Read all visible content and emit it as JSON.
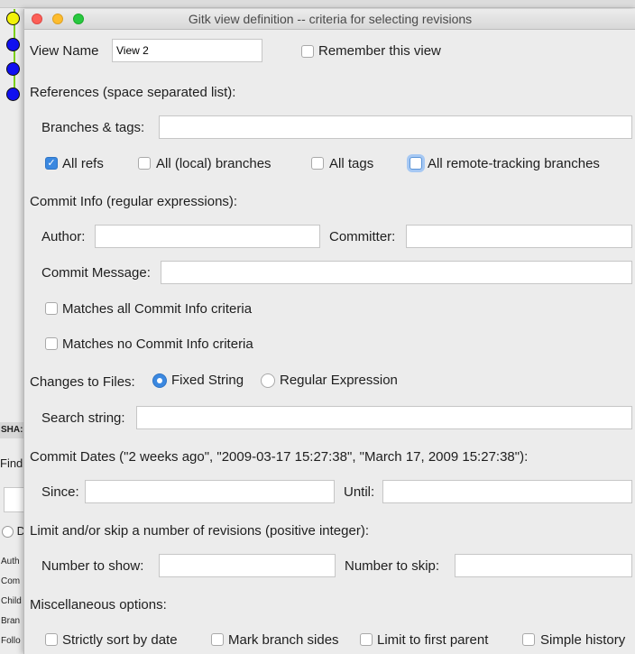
{
  "window": {
    "title": "Gitk view definition -- criteria for selecting revisions"
  },
  "background": {
    "sha_label": "SHA:",
    "find_label": "Find",
    "radio_label": "D",
    "list": [
      "Auth",
      "Com",
      "Child",
      "Bran",
      "Follo"
    ]
  },
  "view_name": {
    "label": "View Name",
    "value": "View 2"
  },
  "remember": {
    "label": "Remember this view",
    "checked": false
  },
  "references": {
    "heading": "References (space separated list):",
    "branches_label": "Branches & tags:",
    "branches_value": "",
    "all_refs": {
      "label": "All refs",
      "checked": true
    },
    "all_local": {
      "label": "All (local) branches",
      "checked": false
    },
    "all_tags": {
      "label": "All tags",
      "checked": false
    },
    "all_remote": {
      "label": "All remote-tracking branches",
      "checked": false
    }
  },
  "commit_info": {
    "heading": "Commit Info (regular expressions):",
    "author_label": "Author:",
    "committer_label": "Committer:",
    "message_label": "Commit Message:",
    "match_all": {
      "label": "Matches all Commit Info criteria",
      "checked": false
    },
    "match_none": {
      "label": "Matches no Commit Info criteria",
      "checked": false
    }
  },
  "files": {
    "heading": "Changes to Files:",
    "fixed": {
      "label": "Fixed String",
      "selected": true
    },
    "regex": {
      "label": "Regular Expression",
      "selected": false
    },
    "search_label": "Search string:"
  },
  "dates": {
    "heading": "Commit Dates (\"2 weeks ago\", \"2009-03-17 15:27:38\", \"March 17, 2009 15:27:38\"):",
    "since_label": "Since:",
    "until_label": "Until:"
  },
  "limit": {
    "heading": "Limit and/or skip a number of revisions (positive integer):",
    "show_label": "Number to show:",
    "skip_label": "Number to skip:"
  },
  "misc": {
    "heading": "Miscellaneous options:",
    "strict_sort": {
      "label": "Strictly sort by date",
      "checked": false
    },
    "mark_sides": {
      "label": "Mark branch sides",
      "checked": false
    },
    "first_parent": {
      "label": "Limit to first parent",
      "checked": false
    },
    "simple_history": {
      "label": "Simple history",
      "checked": false
    }
  },
  "colors": {
    "accent": "#3b88e0",
    "graph_line": "#7ccf1a",
    "node_blue": "#1010f0",
    "node_yellow": "#f2f20a"
  }
}
